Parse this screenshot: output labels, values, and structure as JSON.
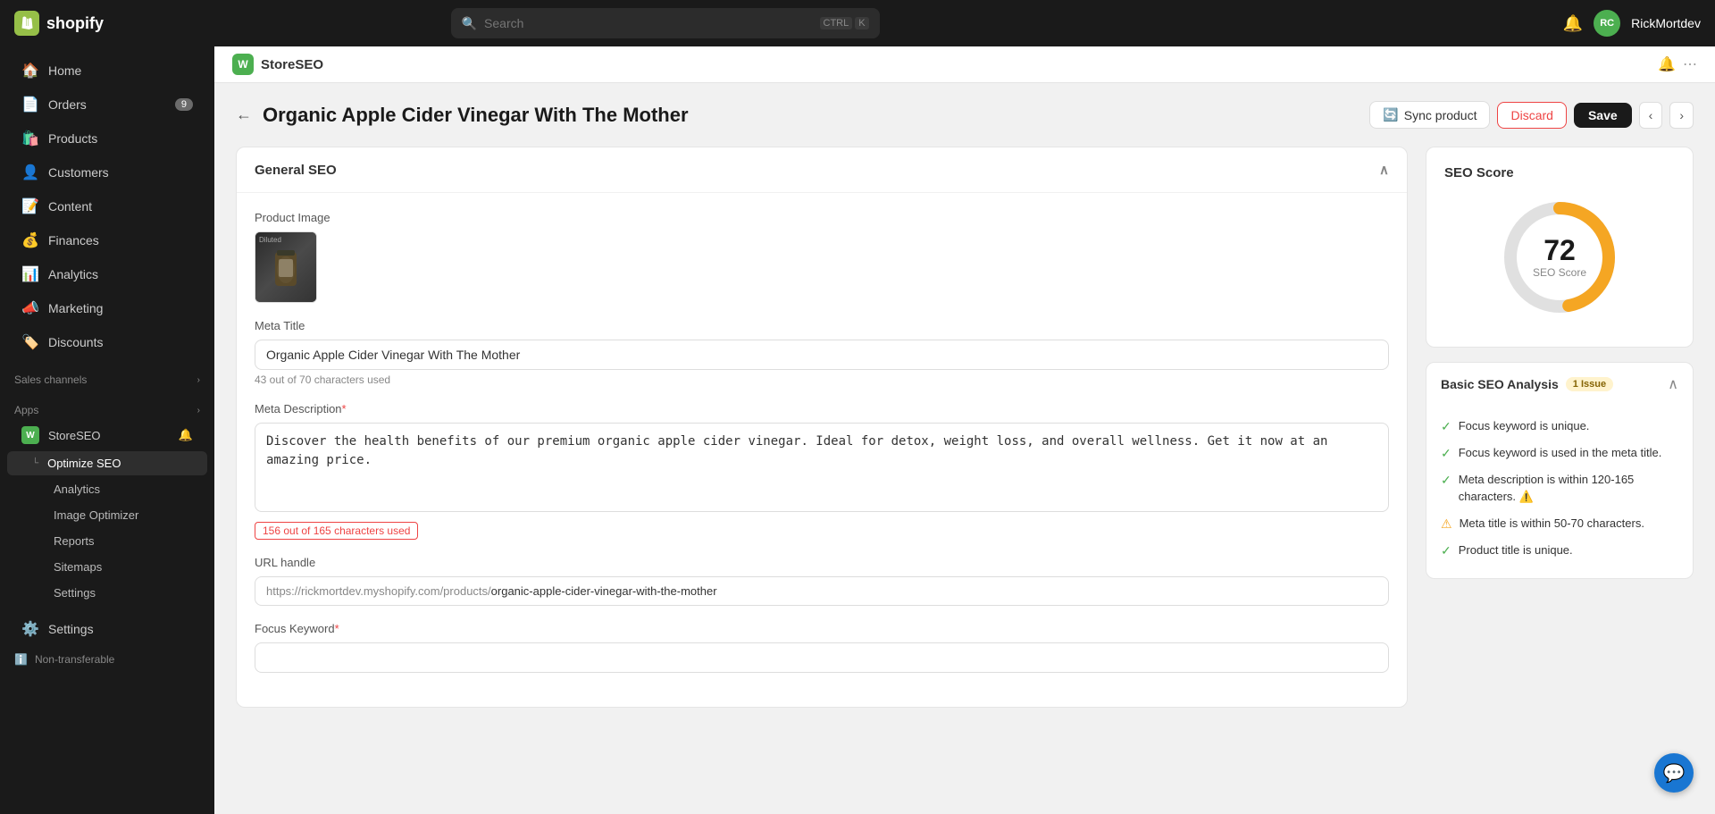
{
  "topbar": {
    "logo_text": "shopify",
    "search_placeholder": "Search",
    "kbd1": "CTRL",
    "kbd2": "K",
    "username": "RickMortdev"
  },
  "sidebar": {
    "main_items": [
      {
        "id": "home",
        "icon": "🏠",
        "label": "Home",
        "badge": null
      },
      {
        "id": "orders",
        "icon": "📄",
        "label": "Orders",
        "badge": "9"
      },
      {
        "id": "products",
        "icon": "🛍️",
        "label": "Products",
        "badge": null
      },
      {
        "id": "customers",
        "icon": "👤",
        "label": "Customers",
        "badge": null
      },
      {
        "id": "content",
        "icon": "📝",
        "label": "Content",
        "badge": null
      },
      {
        "id": "finances",
        "icon": "💰",
        "label": "Finances",
        "badge": null
      },
      {
        "id": "analytics",
        "icon": "📊",
        "label": "Analytics",
        "badge": null
      },
      {
        "id": "marketing",
        "icon": "📣",
        "label": "Marketing",
        "badge": null
      },
      {
        "id": "discounts",
        "icon": "🏷️",
        "label": "Discounts",
        "badge": null
      }
    ],
    "sales_channels_label": "Sales channels",
    "apps_label": "Apps",
    "store_seo_label": "StoreSEO",
    "optimize_seo_label": "Optimize SEO",
    "sub_items": [
      {
        "id": "analytics",
        "label": "Analytics"
      },
      {
        "id": "image-optimizer",
        "label": "Image Optimizer"
      },
      {
        "id": "reports",
        "label": "Reports"
      },
      {
        "id": "sitemaps",
        "label": "Sitemaps"
      },
      {
        "id": "settings",
        "label": "Settings"
      }
    ],
    "settings_label": "Settings",
    "non_transferable_label": "Non-transferable"
  },
  "app_header": {
    "logo_letter": "W",
    "title": "StoreSEO"
  },
  "page": {
    "back_label": "←",
    "title": "Organic Apple Cider Vinegar With The Mother",
    "sync_label": "Sync product",
    "discard_label": "Discard",
    "save_label": "Save",
    "general_seo_label": "General SEO",
    "product_image_label": "Product Image",
    "product_image_tag": "Diluted",
    "meta_title_label": "Meta Title",
    "meta_title_value": "Organic Apple Cider Vinegar With The Mother",
    "meta_title_chars": "43 out of 70 characters used",
    "meta_description_label": "Meta Description",
    "meta_description_req": "*",
    "meta_description_value": "Discover the health benefits of our premium organic apple cider vinegar. Ideal for detox, weight loss, and overall wellness. Get it now at an amazing price.",
    "meta_description_chars": "156 out of 165 characters used",
    "url_handle_label": "URL handle",
    "url_prefix": "https://rickmortdev.myshopify.com/products/",
    "url_slug": "organic-apple-cider-vinegar-with-the-mother",
    "focus_keyword_label": "Focus Keyword",
    "focus_keyword_req": "*"
  },
  "seo_score": {
    "title": "SEO Score",
    "value": 72,
    "label": "SEO Score",
    "score_pct": 72
  },
  "seo_analysis": {
    "title": "Basic SEO Analysis",
    "issue_label": "1 Issue",
    "items": [
      {
        "type": "check",
        "text": "Focus keyword is unique."
      },
      {
        "type": "check",
        "text": "Focus keyword is used in the meta title."
      },
      {
        "type": "check",
        "text": "Meta description is within 120-165 characters. ⚠️"
      },
      {
        "type": "warn",
        "text": "Meta title is within 50-70 characters."
      },
      {
        "type": "check",
        "text": "Product title is unique."
      }
    ]
  },
  "chat": {
    "icon": "💬"
  }
}
